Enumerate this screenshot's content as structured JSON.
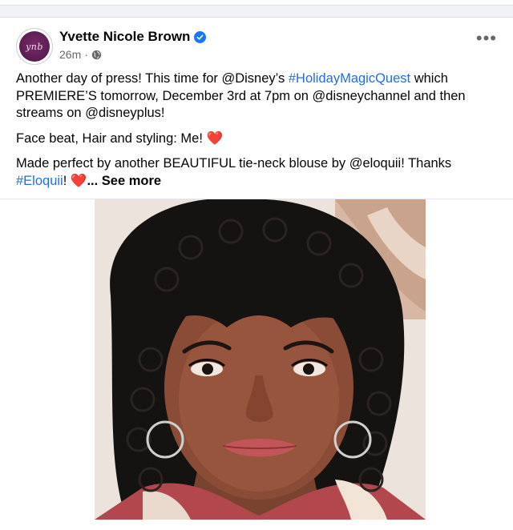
{
  "post": {
    "author": "Yvette Nicole Brown",
    "avatar_text": "ynb",
    "time": "26m",
    "paragraph1": {
      "t1": "Another day of press! This time for @Disney’s ",
      "tag1": "#HolidayMagicQuest",
      "t2": " which PREMIERE’S tomorrow, December 3rd at 7pm on @disneychannel and then streams on @disneyplus!"
    },
    "paragraph2": {
      "t1": "Face beat, Hair and styling: Me! ",
      "heart": "❤️"
    },
    "paragraph3": {
      "t1": "Made perfect by another BEAUTIFUL tie-neck blouse by @eloquii! Thanks ",
      "tag": "#Eloquii",
      "t2": "! ",
      "heart": "❤️",
      "ellipsis": "...",
      "see_more": "See more"
    },
    "more_icon": "more-horizontal-icon",
    "globe_icon": "globe-icon",
    "verified_icon": "verified-badge-icon"
  },
  "colors": {
    "link": "#216fdb",
    "verified": "#1877f2",
    "heart": "#e41e3f",
    "muted": "#65676b"
  }
}
